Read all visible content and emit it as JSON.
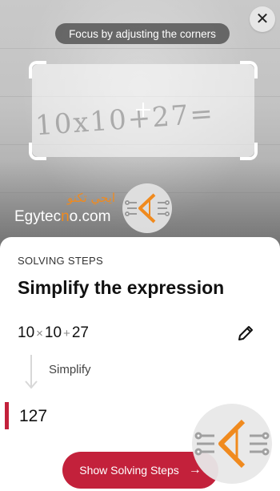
{
  "camera": {
    "hint": "Focus by adjusting the corners",
    "captured_text": "10x10+27="
  },
  "watermark": {
    "arabic": "ايجي تكنو",
    "latin_prefix": "Egytec",
    "latin_o": "n",
    "latin_suffix": "o.com",
    "brand_color": "#f08a1e"
  },
  "sheet": {
    "label": "SOLVING STEPS",
    "title": "Simplify the expression",
    "expression": {
      "a": "10",
      "op1": "×",
      "b": "10",
      "op2": "+",
      "c": "27"
    },
    "step_label": "Simplify",
    "result": "127",
    "cta_label": "Show Solving Steps",
    "accent_color": "#c3213b"
  },
  "icons": {
    "close": "close-icon",
    "edit": "pencil-icon",
    "arrow": "arrow-right-icon",
    "step": "arrow-down-icon"
  }
}
